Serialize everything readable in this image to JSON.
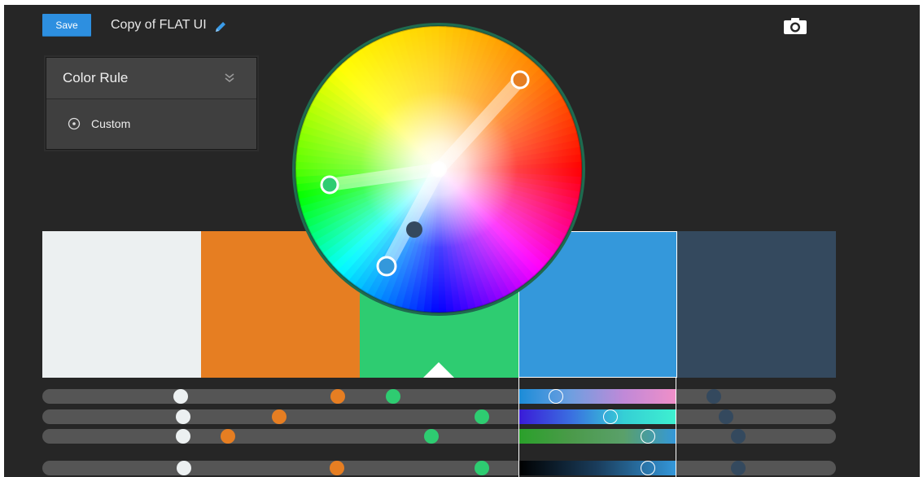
{
  "toolbar": {
    "save_label": "Save",
    "theme_title": "Copy of FLAT UI",
    "edit_icon": "pencil-icon",
    "capture_icon": "camera-icon",
    "accent_color": "#2d8fe0"
  },
  "color_rule": {
    "title": "Color Rule",
    "toggle_icon": "double-chevron-down-icon",
    "options": [
      {
        "label": "Custom",
        "icon": "radio-selected-icon",
        "selected": true
      }
    ]
  },
  "swatches": [
    {
      "color": "#ECF0F1",
      "selected": false
    },
    {
      "color": "#E67E22",
      "selected": false
    },
    {
      "color": "#2ECC71",
      "selected": false
    },
    {
      "color": "#3498DB",
      "selected": true
    },
    {
      "color": "#34495E",
      "selected": false
    }
  ],
  "sliders": [
    {
      "channel": "hue"
    },
    {
      "channel": "saturation"
    },
    {
      "channel": "brightness"
    },
    {
      "channel": "value"
    }
  ]
}
